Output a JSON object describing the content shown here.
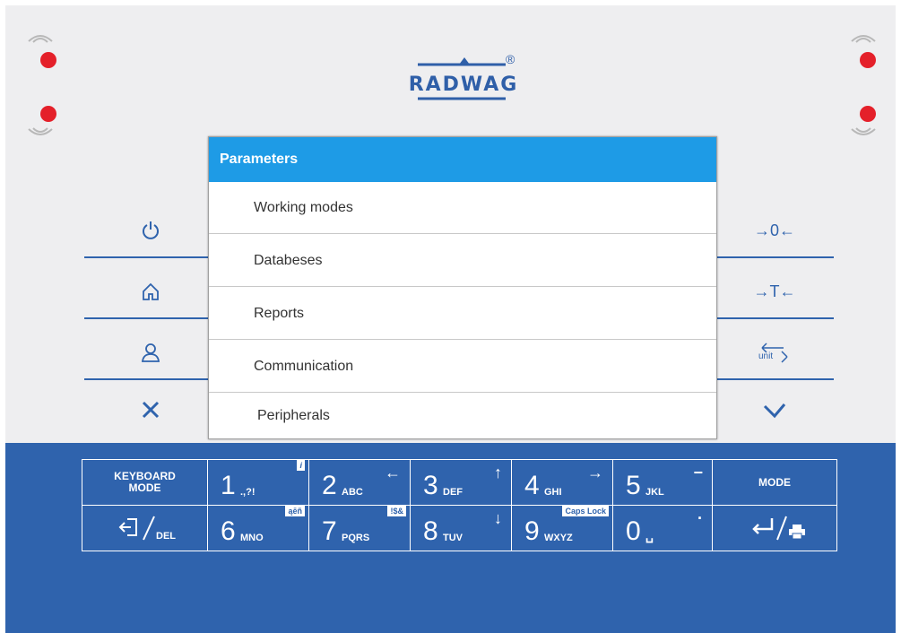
{
  "brand": {
    "logo_text": "RADWAG",
    "registered": "®"
  },
  "dialog": {
    "title": "Parameters",
    "items": [
      {
        "label": "Working modes"
      },
      {
        "label": "Databeses"
      },
      {
        "label": "Reports"
      },
      {
        "label": "Communication"
      },
      {
        "label": "Peripherals"
      }
    ]
  },
  "right_buttons": {
    "zero": "→0←",
    "tare": "→T←",
    "unit": "unit"
  },
  "keyboard": {
    "keyboard_mode": "KEYBOARD MODE",
    "mode": "MODE",
    "del": "DEL",
    "keys": [
      {
        "digit": "1",
        "letters": ".,?!",
        "badge": "i"
      },
      {
        "digit": "2",
        "letters": "ABC",
        "arrow": "←"
      },
      {
        "digit": "3",
        "letters": "DEF",
        "arrow": "↑"
      },
      {
        "digit": "4",
        "letters": "GHI",
        "arrow": "→"
      },
      {
        "digit": "5",
        "letters": "JKL",
        "arrow": "−"
      },
      {
        "digit": "6",
        "letters": "MNO",
        "badge": "ąēñ"
      },
      {
        "digit": "7",
        "letters": "PQRS",
        "badge": "!$&"
      },
      {
        "digit": "8",
        "letters": "TUV",
        "arrow": "↓"
      },
      {
        "digit": "9",
        "letters": "WXYZ",
        "badge": "Caps Lock"
      },
      {
        "digit": "0",
        "letters": "␣",
        "arrow": "·"
      }
    ]
  },
  "colors": {
    "led": "#e4202a",
    "brand_blue": "#2f63ad",
    "header_blue": "#1e9be6"
  }
}
